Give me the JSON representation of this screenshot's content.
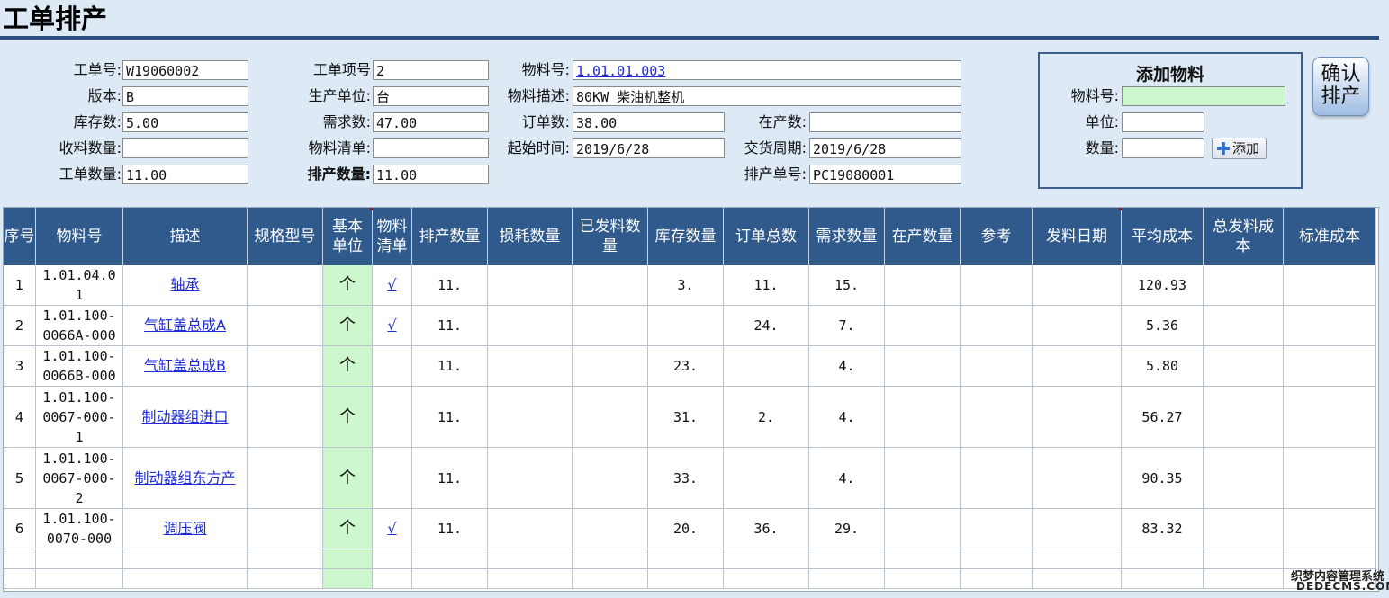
{
  "page": {
    "title": "工单排产"
  },
  "form": {
    "work_order_no_label": "工单号:",
    "work_order_no": "W19060002",
    "version_label": "版本:",
    "version": "B",
    "stock_qty_label": "库存数:",
    "stock_qty": "5.00",
    "received_qty_label": "收料数量:",
    "received_qty": "",
    "work_order_qty_label": "工单数量:",
    "work_order_qty": "11.00",
    "item_no_label": "工单项号",
    "item_no": "2",
    "prod_unit_label": "生产单位:",
    "prod_unit": "台",
    "demand_qty_label": "需求数:",
    "demand_qty": "47.00",
    "bom_label": "物料清单:",
    "bom": "",
    "schedule_qty_label": "排产数量:",
    "schedule_qty": "11.00",
    "material_no_label": "物料号:",
    "material_no": "1.01.01.003",
    "material_desc_label": "物料描述:",
    "material_desc": "80KW 柴油机整机",
    "order_qty_label": "订单数:",
    "order_qty": "38.00",
    "start_time_label": "起始时间:",
    "start_time": "2019/6/28",
    "in_production_label": "在产数:",
    "in_production": "",
    "delivery_label": "交货周期:",
    "delivery": "2019/6/28",
    "schedule_no_label": "排产单号:",
    "schedule_no": "PC19080001"
  },
  "add_material": {
    "heading": "添加物料",
    "material_no_label": "物料号:",
    "material_no": "",
    "unit_label": "单位:",
    "unit": "",
    "qty_label": "数量:",
    "qty": "",
    "add_button": "添加"
  },
  "confirm_button": {
    "line1": "确认",
    "line2": "排产"
  },
  "table": {
    "columns": [
      "序号",
      "物料号",
      "描述",
      "规格型号",
      "基本单位",
      "物料清单",
      "排产数量",
      "损耗数量",
      "已发料数量",
      "库存数量",
      "订单总数",
      "需求数量",
      "在产数量",
      "参考",
      "发料日期",
      "平均成本",
      "总发料成本",
      "标准成本"
    ],
    "rows": [
      {
        "seq": "1",
        "material_no": "1.01.04.01",
        "desc": "轴承",
        "spec": "",
        "unit": "个",
        "bom": "√",
        "sched": "11.",
        "loss": "",
        "issued": "",
        "stock": "3.",
        "order": "11.",
        "demand": "15.",
        "inprod": "",
        "ref": "",
        "issue_date": "",
        "avg_cost": "120.93",
        "total_cost": "",
        "std_cost": ""
      },
      {
        "seq": "2",
        "material_no": "1.01.100-0066A-000",
        "desc": "气缸盖总成A",
        "spec": "",
        "unit": "个",
        "bom": "√",
        "sched": "11.",
        "loss": "",
        "issued": "",
        "stock": "",
        "order": "24.",
        "demand": "7.",
        "inprod": "",
        "ref": "",
        "issue_date": "",
        "avg_cost": "5.36",
        "total_cost": "",
        "std_cost": ""
      },
      {
        "seq": "3",
        "material_no": "1.01.100-0066B-000",
        "desc": "气缸盖总成B",
        "spec": "",
        "unit": "个",
        "bom": "",
        "sched": "11.",
        "loss": "",
        "issued": "",
        "stock": "23.",
        "order": "",
        "demand": "4.",
        "inprod": "",
        "ref": "",
        "issue_date": "",
        "avg_cost": "5.80",
        "total_cost": "",
        "std_cost": ""
      },
      {
        "seq": "4",
        "material_no": "1.01.100-0067-000-1",
        "desc": "制动器组进口",
        "spec": "",
        "unit": "个",
        "bom": "",
        "sched": "11.",
        "loss": "",
        "issued": "",
        "stock": "31.",
        "order": "2.",
        "demand": "4.",
        "inprod": "",
        "ref": "",
        "issue_date": "",
        "avg_cost": "56.27",
        "total_cost": "",
        "std_cost": ""
      },
      {
        "seq": "5",
        "material_no": "1.01.100-0067-000-2",
        "desc": "制动器组东方产",
        "spec": "",
        "unit": "个",
        "bom": "",
        "sched": "11.",
        "loss": "",
        "issued": "",
        "stock": "33.",
        "order": "",
        "demand": "4.",
        "inprod": "",
        "ref": "",
        "issue_date": "",
        "avg_cost": "90.35",
        "total_cost": "",
        "std_cost": ""
      },
      {
        "seq": "6",
        "material_no": "1.01.100-0070-000",
        "desc": "调压阀",
        "spec": "",
        "unit": "个",
        "bom": "√",
        "sched": "11.",
        "loss": "",
        "issued": "",
        "stock": "20.",
        "order": "36.",
        "demand": "29.",
        "inprod": "",
        "ref": "",
        "issue_date": "",
        "avg_cost": "83.32",
        "total_cost": "",
        "std_cost": ""
      }
    ]
  },
  "watermark": {
    "line1": "织梦内容管理系统",
    "line2": "DEDECMS.COM"
  }
}
